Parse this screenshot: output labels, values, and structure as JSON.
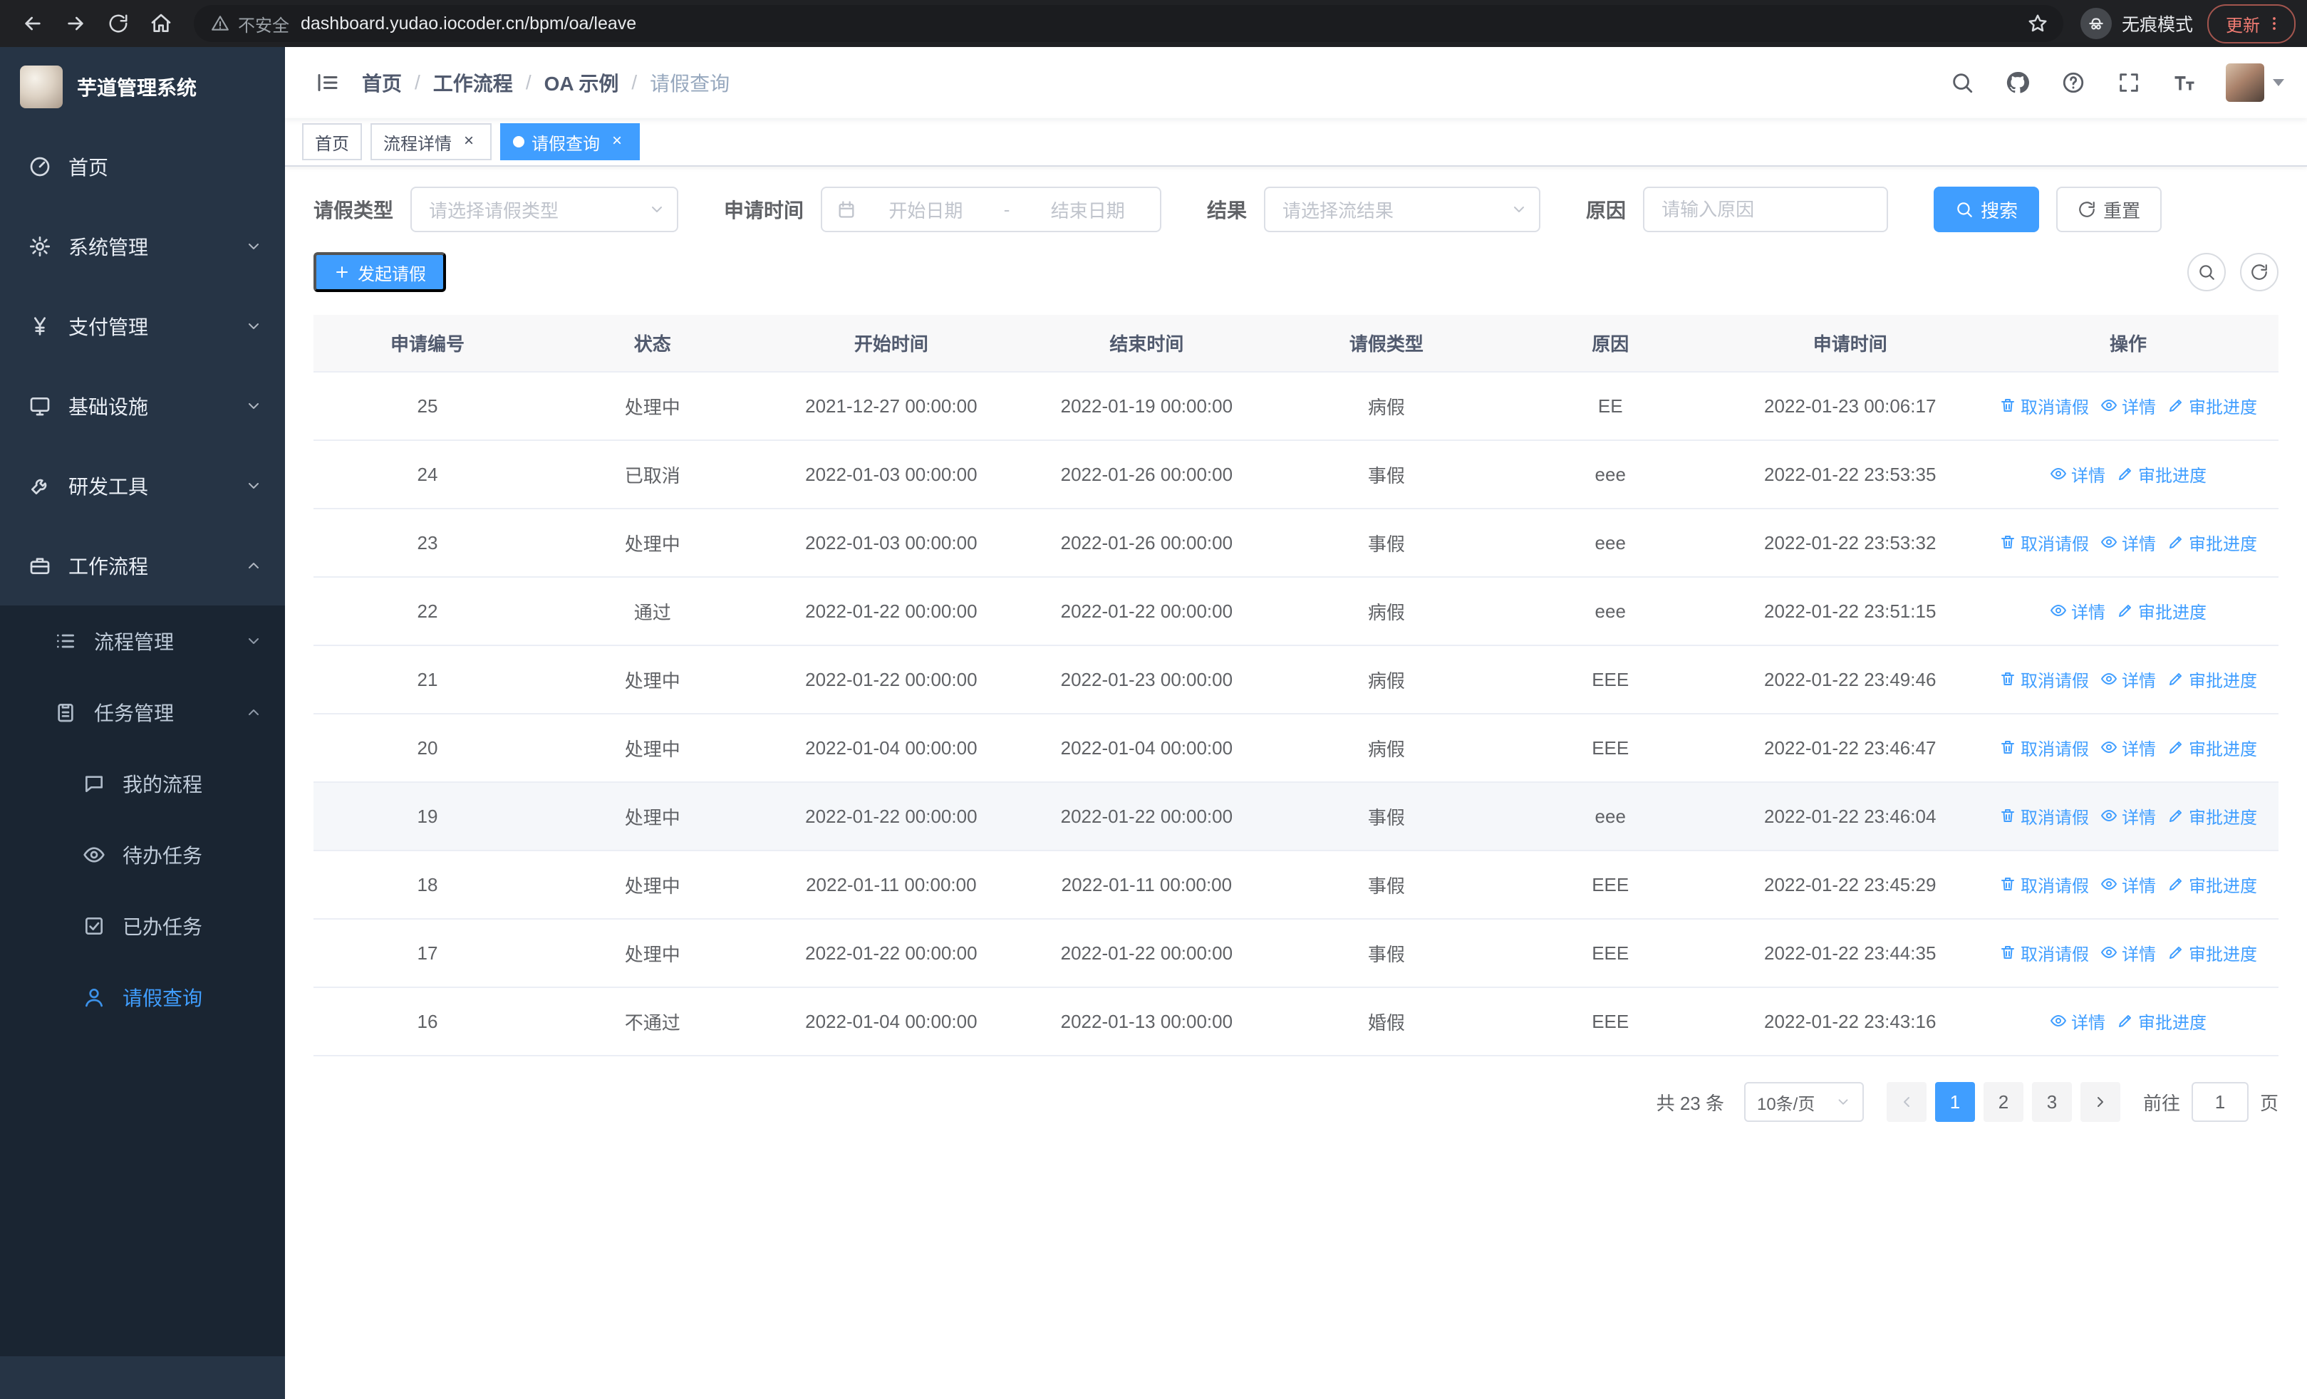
{
  "colors": {
    "primary": "#409eff",
    "sidebar_bg": "#263445",
    "sidebar_submenu_bg": "#1a2532"
  },
  "browser": {
    "security_warning": "不安全",
    "url": "dashboard.yudao.iocoder.cn/bpm/oa/leave",
    "incognito_label": "无痕模式",
    "update_label": "更新"
  },
  "sidebar": {
    "logo_title": "芋道管理系统",
    "home": "首页",
    "system": "系统管理",
    "payment": "支付管理",
    "infra": "基础设施",
    "devtools": "研发工具",
    "workflow": "工作流程",
    "process_mgmt": "流程管理",
    "task_mgmt": "任务管理",
    "my_process": "我的流程",
    "todo_tasks": "待办任务",
    "done_tasks": "已办任务",
    "leave_query": "请假查询"
  },
  "breadcrumb": {
    "items": [
      "首页",
      "工作流程",
      "OA 示例",
      "请假查询"
    ],
    "separator": "/"
  },
  "tabs": [
    {
      "label": "首页",
      "closable": false,
      "active": false
    },
    {
      "label": "流程详情",
      "closable": true,
      "active": false
    },
    {
      "label": "请假查询",
      "closable": true,
      "active": true
    }
  ],
  "filters": {
    "leave_type_label": "请假类型",
    "leave_type_placeholder": "请选择请假类型",
    "apply_time_label": "申请时间",
    "date_start_placeholder": "开始日期",
    "date_separator": "-",
    "date_end_placeholder": "结束日期",
    "result_label": "结果",
    "result_placeholder": "请选择流结果",
    "reason_label": "原因",
    "reason_placeholder": "请输入原因",
    "search_label": "搜索",
    "reset_label": "重置"
  },
  "toolbar": {
    "create_label": "发起请假"
  },
  "table": {
    "columns": [
      "申请编号",
      "状态",
      "开始时间",
      "结束时间",
      "请假类型",
      "原因",
      "申请时间",
      "操作"
    ],
    "actions": {
      "cancel": "取消请假",
      "detail": "详情",
      "progress": "审批进度"
    },
    "rows": [
      {
        "no": "25",
        "status": "处理中",
        "start": "2021-12-27 00:00:00",
        "end": "2022-01-19 00:00:00",
        "type": "病假",
        "reason": "EE",
        "applied": "2022-01-23 00:06:17",
        "cancelable": true,
        "highlight": false
      },
      {
        "no": "24",
        "status": "已取消",
        "start": "2022-01-03 00:00:00",
        "end": "2022-01-26 00:00:00",
        "type": "事假",
        "reason": "eee",
        "applied": "2022-01-22 23:53:35",
        "cancelable": false,
        "highlight": false
      },
      {
        "no": "23",
        "status": "处理中",
        "start": "2022-01-03 00:00:00",
        "end": "2022-01-26 00:00:00",
        "type": "事假",
        "reason": "eee",
        "applied": "2022-01-22 23:53:32",
        "cancelable": true,
        "highlight": false
      },
      {
        "no": "22",
        "status": "通过",
        "start": "2022-01-22 00:00:00",
        "end": "2022-01-22 00:00:00",
        "type": "病假",
        "reason": "eee",
        "applied": "2022-01-22 23:51:15",
        "cancelable": false,
        "highlight": false
      },
      {
        "no": "21",
        "status": "处理中",
        "start": "2022-01-22 00:00:00",
        "end": "2022-01-23 00:00:00",
        "type": "病假",
        "reason": "EEE",
        "applied": "2022-01-22 23:49:46",
        "cancelable": true,
        "highlight": false
      },
      {
        "no": "20",
        "status": "处理中",
        "start": "2022-01-04 00:00:00",
        "end": "2022-01-04 00:00:00",
        "type": "病假",
        "reason": "EEE",
        "applied": "2022-01-22 23:46:47",
        "cancelable": true,
        "highlight": false
      },
      {
        "no": "19",
        "status": "处理中",
        "start": "2022-01-22 00:00:00",
        "end": "2022-01-22 00:00:00",
        "type": "事假",
        "reason": "eee",
        "applied": "2022-01-22 23:46:04",
        "cancelable": true,
        "highlight": true
      },
      {
        "no": "18",
        "status": "处理中",
        "start": "2022-01-11 00:00:00",
        "end": "2022-01-11 00:00:00",
        "type": "事假",
        "reason": "EEE",
        "applied": "2022-01-22 23:45:29",
        "cancelable": true,
        "highlight": false
      },
      {
        "no": "17",
        "status": "处理中",
        "start": "2022-01-22 00:00:00",
        "end": "2022-01-22 00:00:00",
        "type": "事假",
        "reason": "EEE",
        "applied": "2022-01-22 23:44:35",
        "cancelable": true,
        "highlight": false
      },
      {
        "no": "16",
        "status": "不通过",
        "start": "2022-01-04 00:00:00",
        "end": "2022-01-13 00:00:00",
        "type": "婚假",
        "reason": "EEE",
        "applied": "2022-01-22 23:43:16",
        "cancelable": false,
        "highlight": false
      }
    ]
  },
  "pagination": {
    "total": "共 23 条",
    "page_size": "10条/页",
    "pages": [
      "1",
      "2",
      "3"
    ],
    "active_page": "1",
    "goto_prefix": "前往",
    "goto_value": "1",
    "goto_suffix": "页"
  }
}
